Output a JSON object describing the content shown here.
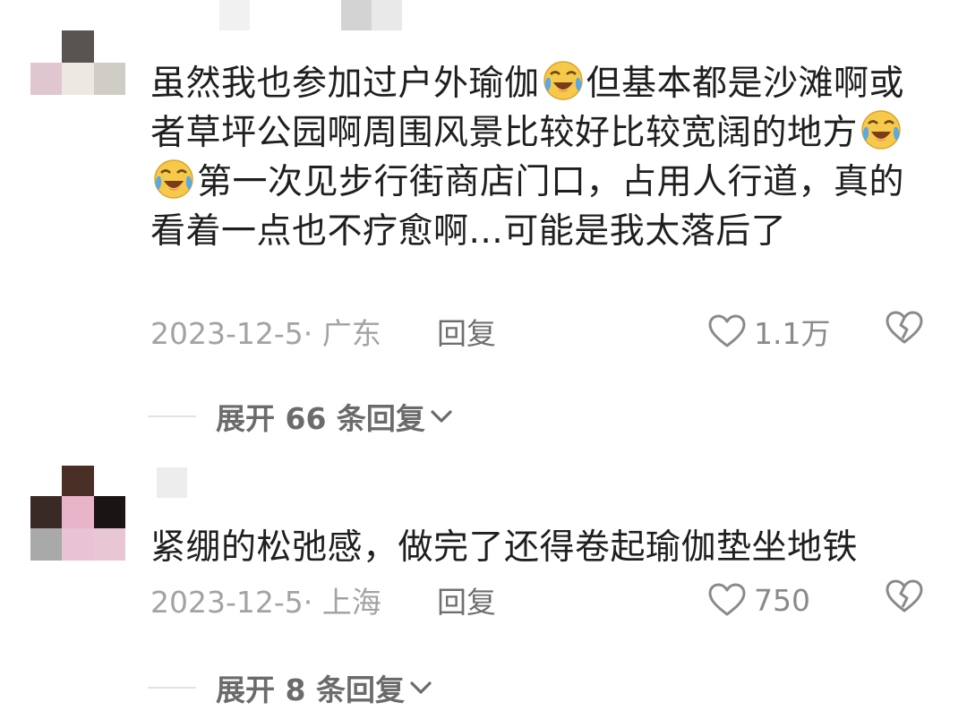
{
  "comments": [
    {
      "text_parts": [
        "虽然我也参加过户外瑜伽",
        "但基本都是沙滩啊或者草坪公园啊周围风景比较好比较宽阔的地方",
        "第一次见步行街商店门口，占用人行道，真的看着一点也不疗愈啊...可能是我太落后了"
      ],
      "emoji_icon": "crying-laugh-emoji",
      "date_location": "2023-12-5· 广东",
      "reply_label": "回复",
      "like_count": "1.1万",
      "expand_label": "展开 66 条回复"
    },
    {
      "text": "紧绷的松弛感，做完了还得卷起瑜伽垫坐地铁",
      "date_location": "2023-12-5· 上海",
      "reply_label": "回复",
      "like_count": "750",
      "expand_label": "展开 8 条回复"
    }
  ],
  "colors": {
    "text": "#1f1f1f",
    "meta": "#a3a3a3",
    "expand": "#6b6b6b",
    "emoji_face": "#f7c94a",
    "emoji_tears": "#5aa9e6"
  }
}
